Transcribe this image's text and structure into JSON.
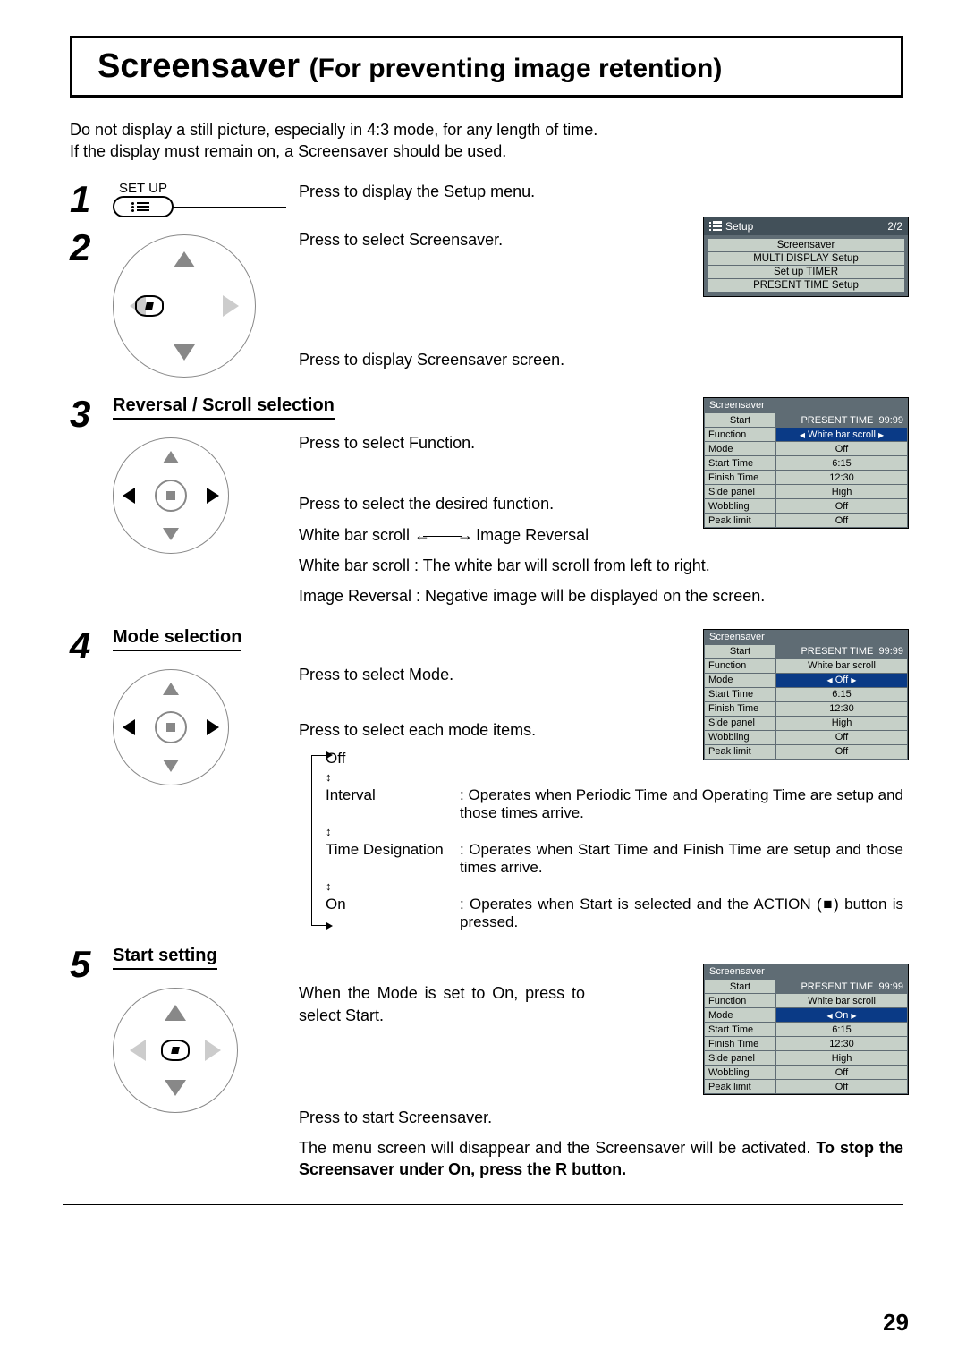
{
  "title_main": "Screensaver",
  "title_paren": "(For preventing image retention)",
  "intro_line1": "Do not display a still picture, especially in 4:3 mode, for any length of time.",
  "intro_line2": "If the display must remain on, a Screensaver should be used.",
  "step1": {
    "setup_label": "SET UP",
    "text": "Press to display the Setup menu."
  },
  "step2": {
    "t1": "Press to select Screensaver.",
    "t2": "Press to display Screensaver screen."
  },
  "setup_menu": {
    "header": "Setup",
    "page": "2/2",
    "items": [
      "Screensaver",
      "MULTI DISPLAY Setup",
      "Set up TIMER",
      "PRESENT TIME Setup"
    ]
  },
  "step3": {
    "heading": "Reversal / Scroll selection",
    "t1": "Press to select Function.",
    "t2": "Press to select the desired function.",
    "cycle_a": "White bar scroll",
    "cycle_b": "Image Reversal",
    "note_a": "White bar scroll : The white bar will scroll from left to right.",
    "note_b": "Image Reversal : Negative image will be displayed on the screen."
  },
  "ss_menu": {
    "title": "Screensaver",
    "present_label": "PRESENT TIME",
    "present_val": "99:99",
    "rows": [
      {
        "label": "Start",
        "value": ""
      },
      {
        "label": "Function",
        "value": "White bar scroll"
      },
      {
        "label": "Mode",
        "value": "Off"
      },
      {
        "label": "Start Time",
        "value": "6:15"
      },
      {
        "label": "Finish Time",
        "value": "12:30"
      },
      {
        "label": "Side panel",
        "value": "High"
      },
      {
        "label": "Wobbling",
        "value": "Off"
      },
      {
        "label": "Peak limit",
        "value": "Off"
      }
    ]
  },
  "step4": {
    "heading": "Mode selection",
    "t1": "Press to select Mode.",
    "t2": "Press to select each mode items.",
    "modes": {
      "off": "Off",
      "interval": "Interval",
      "interval_desc": ": Operates when Periodic Time and Operating Time are setup and those times arrive.",
      "timedes": "Time Designation",
      "timedes_desc": ": Operates when Start Time and Finish Time are setup and those times arrive.",
      "on": "On",
      "on_desc": ": Operates when Start is selected and the ACTION (■) button is pressed."
    }
  },
  "ss_menu_4_mode": "Off",
  "step5": {
    "heading": "Start setting",
    "t1": "When the Mode is set to On, press to select Start.",
    "t2": "Press to start Screensaver.",
    "t3a": "The menu screen will disappear and the Screensaver will be activated. ",
    "t3b": "To stop the Screensaver under On, press the R button."
  },
  "ss_menu_5_mode": "On",
  "page_number": "29"
}
